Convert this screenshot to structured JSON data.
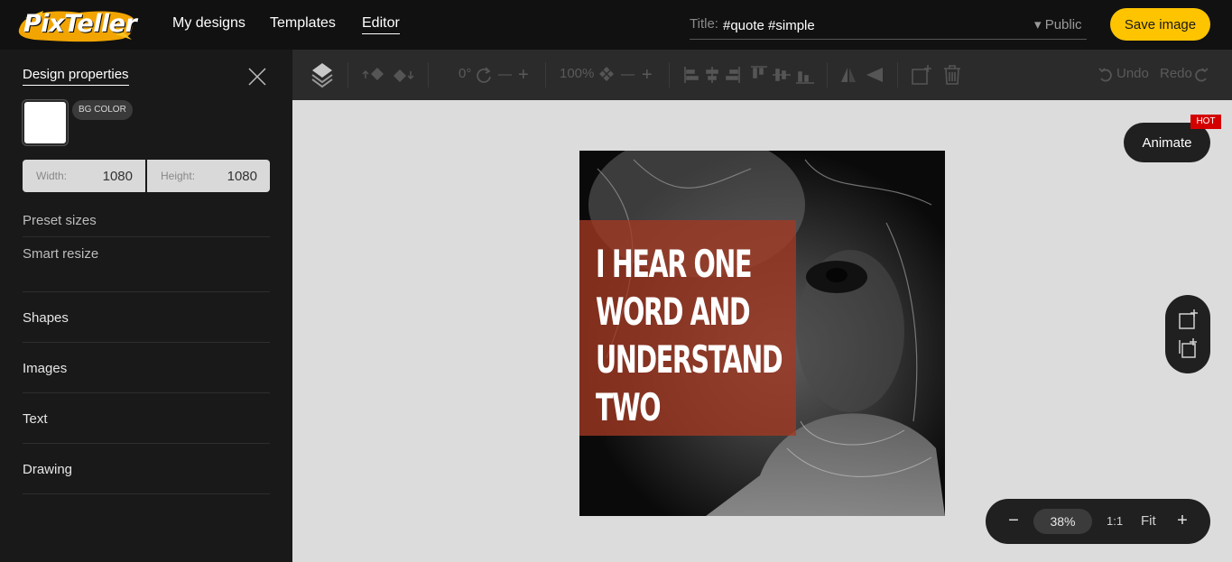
{
  "app": {
    "logo_text": "PixTeller"
  },
  "nav": {
    "items": [
      {
        "label": "My designs"
      },
      {
        "label": "Templates"
      },
      {
        "label": "Editor"
      }
    ]
  },
  "header": {
    "title_label": "Title:",
    "title_value": "#quote #simple",
    "visibility_label": "▾ Public",
    "save_label": "Save image"
  },
  "sidebar": {
    "title": "Design properties",
    "bg_color_label": "BG COLOR",
    "bg_color": "#ffffff",
    "width_label": "Width:",
    "width_value": "1080",
    "height_label": "Height:",
    "height_value": "1080",
    "preset_sizes": "Preset sizes",
    "smart_resize": "Smart resize",
    "sections": [
      {
        "label": "Shapes"
      },
      {
        "label": "Images"
      },
      {
        "label": "Text"
      },
      {
        "label": "Drawing"
      }
    ]
  },
  "toolbar": {
    "rotation": "0°",
    "opacity": "100%",
    "undo": "Undo",
    "redo": "Redo"
  },
  "canvas": {
    "quote_lines": [
      "I HEAR ONE",
      "WORD AND",
      "UNDERSTAND",
      "TWO"
    ],
    "quote_bg_color": "#a33922"
  },
  "floating": {
    "animate_label": "Animate",
    "hot_label": "HOT"
  },
  "zoom": {
    "level": "38%",
    "one_to_one": "1:1",
    "fit": "Fit"
  },
  "colors": {
    "accent": "#ffc400",
    "topbar": "#111111",
    "sidebar": "#191919",
    "toolbar": "#2b2b2b",
    "workspace": "#dcdcdc",
    "hot": "#d40000"
  }
}
